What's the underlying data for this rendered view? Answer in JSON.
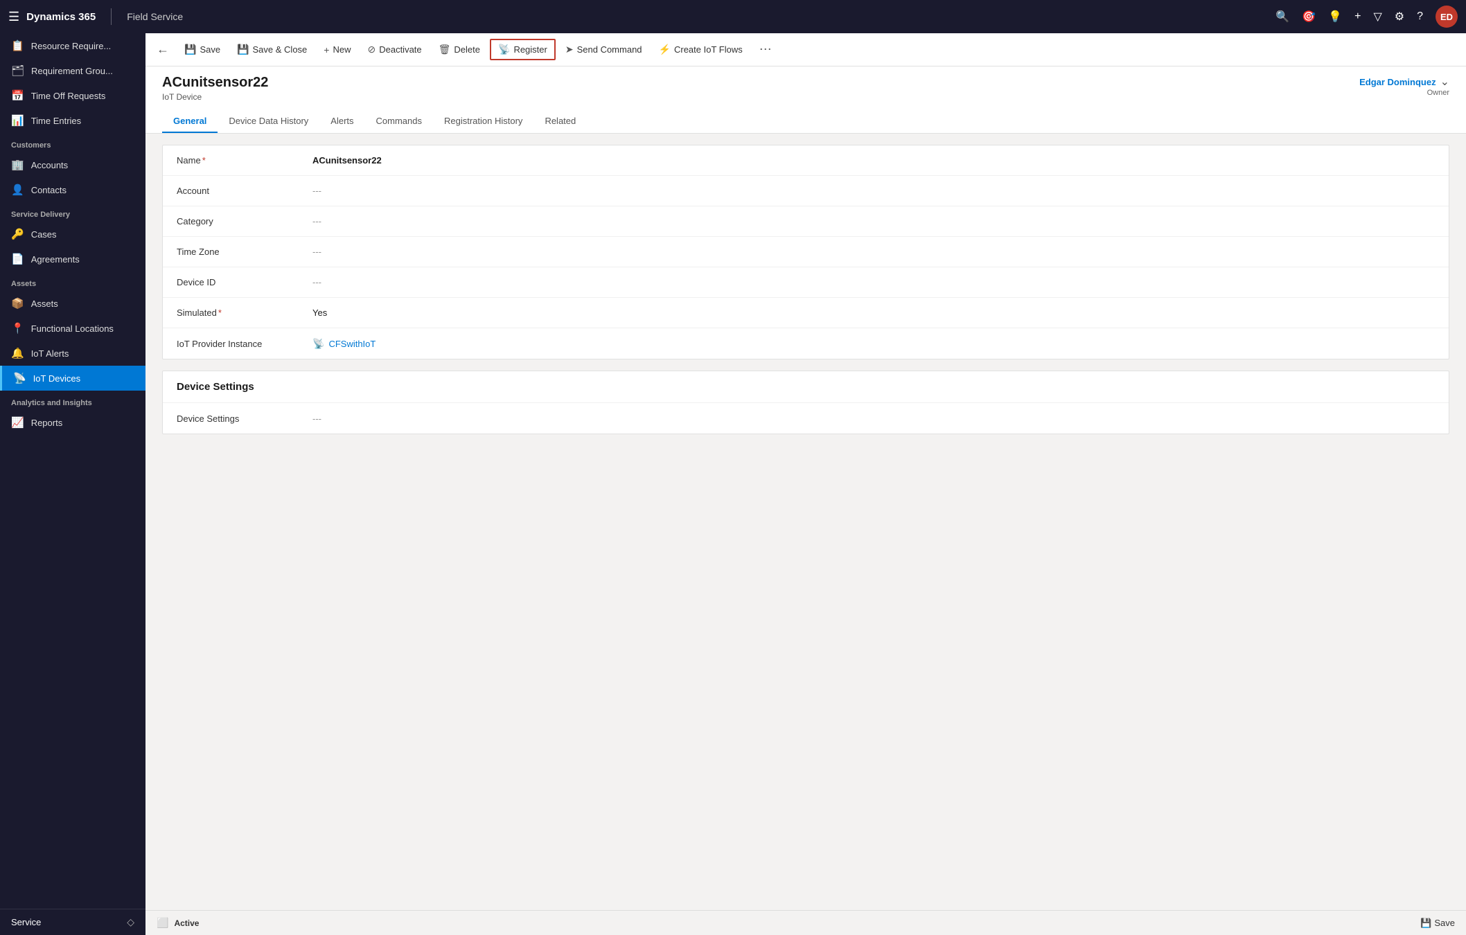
{
  "app": {
    "brand": "Dynamics 365",
    "module": "Field Service",
    "nav_icons": [
      "🔍",
      "🎯",
      "💡",
      "+",
      "▽",
      "⚙",
      "?"
    ],
    "avatar_initials": "ED"
  },
  "sidebar": {
    "menu_icon": "☰",
    "sections": [
      {
        "items": [
          {
            "id": "resource-req",
            "icon": "📋",
            "label": "Resource Require..."
          },
          {
            "id": "requirement-group",
            "icon": "🗂",
            "label": "Requirement Grou..."
          },
          {
            "id": "time-off",
            "icon": "📅",
            "label": "Time Off Requests"
          },
          {
            "id": "time-entries",
            "icon": "📊",
            "label": "Time Entries"
          }
        ]
      },
      {
        "label": "Customers",
        "items": [
          {
            "id": "accounts",
            "icon": "🏢",
            "label": "Accounts"
          },
          {
            "id": "contacts",
            "icon": "👤",
            "label": "Contacts"
          }
        ]
      },
      {
        "label": "Service Delivery",
        "items": [
          {
            "id": "cases",
            "icon": "🔑",
            "label": "Cases"
          },
          {
            "id": "agreements",
            "icon": "📄",
            "label": "Agreements"
          }
        ]
      },
      {
        "label": "Assets",
        "items": [
          {
            "id": "assets",
            "icon": "📦",
            "label": "Assets"
          },
          {
            "id": "functional-locations",
            "icon": "📍",
            "label": "Functional Locations"
          },
          {
            "id": "iot-alerts",
            "icon": "🔔",
            "label": "IoT Alerts"
          },
          {
            "id": "iot-devices",
            "icon": "📡",
            "label": "IoT Devices",
            "active": true
          }
        ]
      },
      {
        "label": "Analytics and Insights",
        "items": [
          {
            "id": "reports",
            "icon": "📈",
            "label": "Reports"
          }
        ]
      }
    ],
    "bottom": {
      "label": "Service",
      "icon": "◇"
    }
  },
  "toolbar": {
    "back_label": "←",
    "buttons": [
      {
        "id": "save",
        "icon": "💾",
        "label": "Save"
      },
      {
        "id": "save-close",
        "icon": "💾",
        "label": "Save & Close"
      },
      {
        "id": "new",
        "icon": "+",
        "label": "New"
      },
      {
        "id": "deactivate",
        "icon": "⊘",
        "label": "Deactivate"
      },
      {
        "id": "delete",
        "icon": "🗑",
        "label": "Delete"
      },
      {
        "id": "register",
        "icon": "📡",
        "label": "Register",
        "highlighted": true
      },
      {
        "id": "send-command",
        "icon": "➤",
        "label": "Send Command"
      },
      {
        "id": "create-iot-flows",
        "icon": "⚡",
        "label": "Create IoT Flows"
      }
    ],
    "more": "⋯"
  },
  "record": {
    "title": "ACunitsensor22",
    "subtitle": "IoT Device",
    "owner_name": "Edgar Dominquez",
    "owner_label": "Owner"
  },
  "tabs": [
    {
      "id": "general",
      "label": "General",
      "active": true
    },
    {
      "id": "device-data-history",
      "label": "Device Data History"
    },
    {
      "id": "alerts",
      "label": "Alerts"
    },
    {
      "id": "commands",
      "label": "Commands"
    },
    {
      "id": "registration-history",
      "label": "Registration History"
    },
    {
      "id": "related",
      "label": "Related"
    }
  ],
  "form": {
    "general_section": {
      "fields": [
        {
          "label": "Name",
          "required": true,
          "value": "ACunitsensor22",
          "type": "text"
        },
        {
          "label": "Account",
          "required": false,
          "value": "---",
          "type": "empty"
        },
        {
          "label": "Category",
          "required": false,
          "value": "---",
          "type": "empty"
        },
        {
          "label": "Time Zone",
          "required": false,
          "value": "---",
          "type": "empty"
        },
        {
          "label": "Device ID",
          "required": false,
          "value": "---",
          "type": "empty"
        },
        {
          "label": "Simulated",
          "required": true,
          "value": "Yes",
          "type": "text"
        },
        {
          "label": "IoT Provider Instance",
          "required": false,
          "value": "CFSwithIoT",
          "type": "link"
        }
      ]
    },
    "device_settings_section": {
      "title": "Device Settings",
      "fields": [
        {
          "label": "Device Settings",
          "required": false,
          "value": "---",
          "type": "empty"
        }
      ]
    }
  },
  "status_bar": {
    "icon": "⬜",
    "status": "Active",
    "save_icon": "💾",
    "save_label": "Save"
  }
}
